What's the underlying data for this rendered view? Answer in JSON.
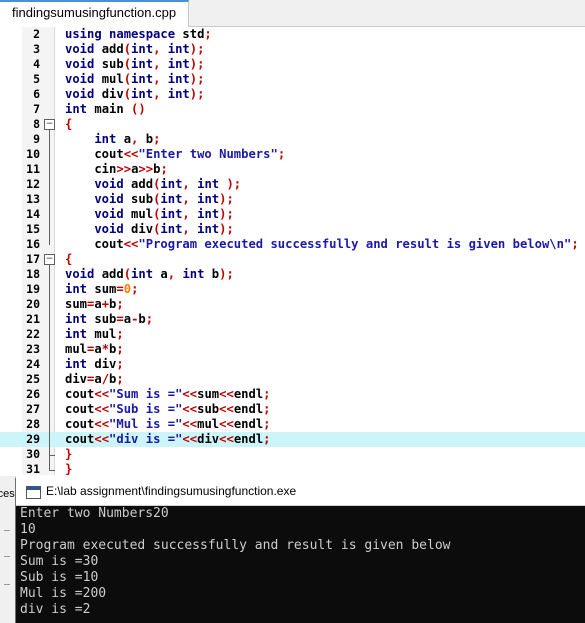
{
  "tab": {
    "title": "findingsumusingfunction.cpp"
  },
  "editor": {
    "lines": [
      {
        "n": "2",
        "tokens": [
          [
            "kw",
            "using namespace "
          ],
          [
            "fn",
            "std"
          ],
          [
            "pn",
            ";"
          ]
        ]
      },
      {
        "n": "3",
        "tokens": [
          [
            "kw",
            "void "
          ],
          [
            "fn",
            "add"
          ],
          [
            "pn",
            "("
          ],
          [
            "kw",
            "int"
          ],
          [
            "pn",
            ", "
          ],
          [
            "kw",
            "int"
          ],
          [
            "pn",
            ");"
          ]
        ]
      },
      {
        "n": "4",
        "tokens": [
          [
            "kw",
            "void "
          ],
          [
            "fn",
            "sub"
          ],
          [
            "pn",
            "("
          ],
          [
            "kw",
            "int"
          ],
          [
            "pn",
            ", "
          ],
          [
            "kw",
            "int"
          ],
          [
            "pn",
            ");"
          ]
        ]
      },
      {
        "n": "5",
        "tokens": [
          [
            "kw",
            "void "
          ],
          [
            "fn",
            "mul"
          ],
          [
            "pn",
            "("
          ],
          [
            "kw",
            "int"
          ],
          [
            "pn",
            ", "
          ],
          [
            "kw",
            "int"
          ],
          [
            "pn",
            ");"
          ]
        ]
      },
      {
        "n": "6",
        "tokens": [
          [
            "kw",
            "void "
          ],
          [
            "fn",
            "div"
          ],
          [
            "pn",
            "("
          ],
          [
            "kw",
            "int"
          ],
          [
            "pn",
            ", "
          ],
          [
            "kw",
            "int"
          ],
          [
            "pn",
            ");"
          ]
        ]
      },
      {
        "n": "7",
        "tokens": [
          [
            "kw",
            "int "
          ],
          [
            "fn",
            "main "
          ],
          [
            "pn",
            "()"
          ]
        ]
      },
      {
        "n": "8",
        "tokens": [
          [
            "pn",
            "{"
          ]
        ]
      },
      {
        "n": "9",
        "tokens": [
          [
            "kw",
            "    int "
          ],
          [
            "fn",
            "a"
          ],
          [
            "pn",
            ", "
          ],
          [
            "fn",
            "b"
          ],
          [
            "pn",
            ";"
          ]
        ]
      },
      {
        "n": "10",
        "tokens": [
          [
            "fn",
            "    cout"
          ],
          [
            "op",
            "<<"
          ],
          [
            "st",
            "\"Enter two Numbers\""
          ],
          [
            "pn",
            ";"
          ]
        ]
      },
      {
        "n": "11",
        "tokens": [
          [
            "fn",
            "    cin"
          ],
          [
            "op",
            ">>"
          ],
          [
            "fn",
            "a"
          ],
          [
            "op",
            ">>"
          ],
          [
            "fn",
            "b"
          ],
          [
            "pn",
            ";"
          ]
        ]
      },
      {
        "n": "12",
        "tokens": [
          [
            "kw",
            "    void "
          ],
          [
            "fn",
            "add"
          ],
          [
            "pn",
            "("
          ],
          [
            "kw",
            "int"
          ],
          [
            "pn",
            ", "
          ],
          [
            "kw",
            "int "
          ],
          [
            "pn",
            ");"
          ]
        ]
      },
      {
        "n": "13",
        "tokens": [
          [
            "kw",
            "    void "
          ],
          [
            "fn",
            "sub"
          ],
          [
            "pn",
            "("
          ],
          [
            "kw",
            "int"
          ],
          [
            "pn",
            ", "
          ],
          [
            "kw",
            "int"
          ],
          [
            "pn",
            ");"
          ]
        ]
      },
      {
        "n": "14",
        "tokens": [
          [
            "kw",
            "    void "
          ],
          [
            "fn",
            "mul"
          ],
          [
            "pn",
            "("
          ],
          [
            "kw",
            "int"
          ],
          [
            "pn",
            ", "
          ],
          [
            "kw",
            "int"
          ],
          [
            "pn",
            ");"
          ]
        ]
      },
      {
        "n": "15",
        "tokens": [
          [
            "kw",
            "    void "
          ],
          [
            "fn",
            "div"
          ],
          [
            "pn",
            "("
          ],
          [
            "kw",
            "int"
          ],
          [
            "pn",
            ", "
          ],
          [
            "kw",
            "int"
          ],
          [
            "pn",
            ");"
          ]
        ]
      },
      {
        "n": "16",
        "tokens": [
          [
            "fn",
            "    cout"
          ],
          [
            "op",
            "<<"
          ],
          [
            "st",
            "\"Program executed successfully and result is given below\\n\""
          ],
          [
            "pn",
            ";"
          ]
        ]
      },
      {
        "n": "17",
        "tokens": [
          [
            "pn",
            "{"
          ]
        ]
      },
      {
        "n": "18",
        "tokens": [
          [
            "kw",
            "void "
          ],
          [
            "fn",
            "add"
          ],
          [
            "pn",
            "("
          ],
          [
            "kw",
            "int "
          ],
          [
            "fn",
            "a"
          ],
          [
            "pn",
            ", "
          ],
          [
            "kw",
            "int "
          ],
          [
            "fn",
            "b"
          ],
          [
            "pn",
            ");"
          ]
        ]
      },
      {
        "n": "19",
        "tokens": [
          [
            "kw",
            "int "
          ],
          [
            "fn",
            "sum"
          ],
          [
            "op",
            "="
          ],
          [
            "nm",
            "0"
          ],
          [
            "pn",
            ";"
          ]
        ]
      },
      {
        "n": "20",
        "tokens": [
          [
            "fn",
            "sum"
          ],
          [
            "op",
            "="
          ],
          [
            "fn",
            "a"
          ],
          [
            "op",
            "+"
          ],
          [
            "fn",
            "b"
          ],
          [
            "pn",
            ";"
          ]
        ]
      },
      {
        "n": "21",
        "tokens": [
          [
            "kw",
            "int "
          ],
          [
            "fn",
            "sub"
          ],
          [
            "op",
            "="
          ],
          [
            "fn",
            "a"
          ],
          [
            "op",
            "-"
          ],
          [
            "fn",
            "b"
          ],
          [
            "pn",
            ";"
          ]
        ]
      },
      {
        "n": "22",
        "tokens": [
          [
            "kw",
            "int "
          ],
          [
            "fn",
            "mul"
          ],
          [
            "pn",
            ";"
          ]
        ]
      },
      {
        "n": "23",
        "tokens": [
          [
            "fn",
            "mul"
          ],
          [
            "op",
            "="
          ],
          [
            "fn",
            "a"
          ],
          [
            "op",
            "*"
          ],
          [
            "fn",
            "b"
          ],
          [
            "pn",
            ";"
          ]
        ]
      },
      {
        "n": "24",
        "tokens": [
          [
            "kw",
            "int "
          ],
          [
            "fn",
            "div"
          ],
          [
            "pn",
            ";"
          ]
        ]
      },
      {
        "n": "25",
        "tokens": [
          [
            "fn",
            "div"
          ],
          [
            "op",
            "="
          ],
          [
            "fn",
            "a"
          ],
          [
            "op",
            "/"
          ],
          [
            "fn",
            "b"
          ],
          [
            "pn",
            ";"
          ]
        ]
      },
      {
        "n": "26",
        "tokens": [
          [
            "fn",
            "cout"
          ],
          [
            "op",
            "<<"
          ],
          [
            "st",
            "\"Sum is =\""
          ],
          [
            "op",
            "<<"
          ],
          [
            "fn",
            "sum"
          ],
          [
            "op",
            "<<"
          ],
          [
            "fn",
            "endl"
          ],
          [
            "pn",
            ";"
          ]
        ]
      },
      {
        "n": "27",
        "tokens": [
          [
            "fn",
            "cout"
          ],
          [
            "op",
            "<<"
          ],
          [
            "st",
            "\"Sub is =\""
          ],
          [
            "op",
            "<<"
          ],
          [
            "fn",
            "sub"
          ],
          [
            "op",
            "<<"
          ],
          [
            "fn",
            "endl"
          ],
          [
            "pn",
            ";"
          ]
        ]
      },
      {
        "n": "28",
        "tokens": [
          [
            "fn",
            "cout"
          ],
          [
            "op",
            "<<"
          ],
          [
            "st",
            "\"Mul is =\""
          ],
          [
            "op",
            "<<"
          ],
          [
            "fn",
            "mul"
          ],
          [
            "op",
            "<<"
          ],
          [
            "fn",
            "endl"
          ],
          [
            "pn",
            ";"
          ]
        ]
      },
      {
        "n": "29",
        "tokens": [
          [
            "fn",
            "cout"
          ],
          [
            "op",
            "<<"
          ],
          [
            "st",
            "\"div is =\""
          ],
          [
            "op",
            "<<"
          ],
          [
            "fn",
            "div"
          ],
          [
            "op",
            "<<"
          ],
          [
            "fn",
            "endl"
          ],
          [
            "pn",
            ";"
          ]
        ]
      },
      {
        "n": "30",
        "tokens": [
          [
            "pn",
            "}"
          ]
        ]
      },
      {
        "n": "31",
        "tokens": [
          [
            "pn",
            "}"
          ]
        ]
      }
    ],
    "highlighted_line": "29",
    "fold_markers": [
      "8",
      "17"
    ]
  },
  "console": {
    "title": "E:\\lab assignment\\findingsumusingfunction.exe",
    "output": [
      "Enter two Numbers20",
      "10",
      "Program executed successfully and result is given below",
      "Sum is =30",
      "Sub is =10",
      "Mul is =200",
      "div is =2"
    ]
  },
  "side_panel": {
    "label": "rces"
  },
  "colors": {
    "keyword": "#000080",
    "string": "#1a1aa6",
    "operator": "#c00000",
    "number": "#f08000",
    "highlight": "#ccf5fa",
    "console_bg": "#0c0c0c",
    "console_text": "#cccccc"
  }
}
